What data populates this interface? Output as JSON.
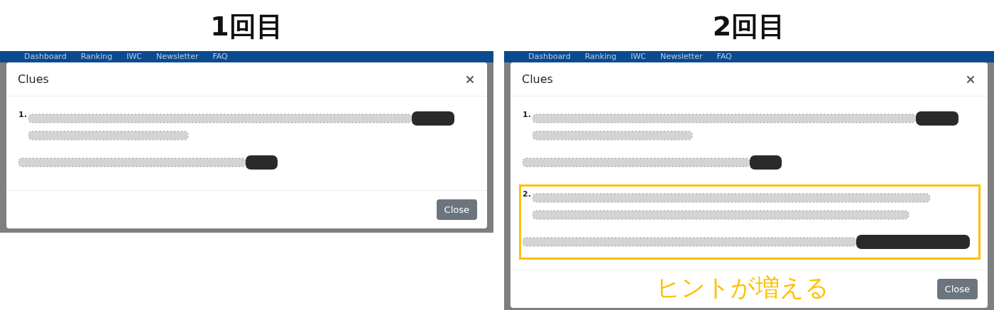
{
  "panels": [
    {
      "heading": "1回目",
      "nav": [
        "Dashboard",
        "Ranking",
        "IWC",
        "Newsletter",
        "FAQ"
      ],
      "modal": {
        "title": "Clues",
        "close_button": "Close",
        "clues": [
          {
            "number": "1.",
            "highlighted": false,
            "paragraphs": [
              {
                "kind": "wrapped-marked"
              },
              {
                "kind": "single-marked"
              }
            ]
          }
        ]
      }
    },
    {
      "heading": "2回目",
      "nav": [
        "Dashboard",
        "Ranking",
        "IWC",
        "Newsletter",
        "FAQ"
      ],
      "annotation": "ヒントが増える",
      "modal": {
        "title": "Clues",
        "close_button": "Close",
        "clues": [
          {
            "number": "1.",
            "highlighted": false,
            "paragraphs": [
              {
                "kind": "wrapped-marked"
              },
              {
                "kind": "single-marked"
              }
            ]
          },
          {
            "number": "2.",
            "highlighted": true,
            "paragraphs": [
              {
                "kind": "wrapped"
              },
              {
                "kind": "single-long-marked"
              }
            ]
          }
        ]
      }
    }
  ]
}
